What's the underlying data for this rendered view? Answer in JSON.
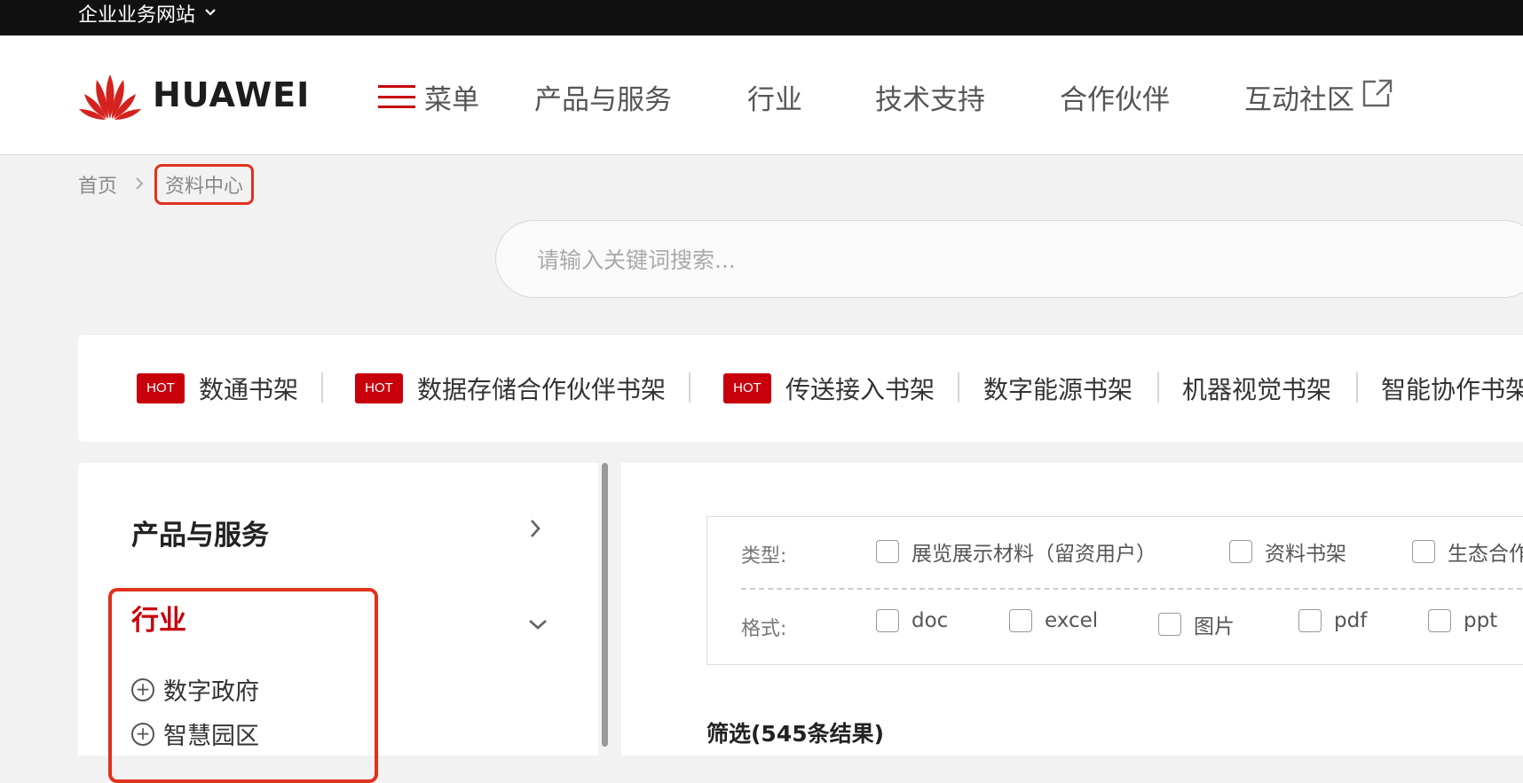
{
  "topbar": {
    "site_label": "企业业务网站",
    "chevron": "chevron-down-icon"
  },
  "header": {
    "logo_text": "HUAWEI",
    "brand_color": "#c7000b",
    "nav": [
      {
        "label": "菜单",
        "icon": "hamburger-icon"
      },
      {
        "label": "产品与服务"
      },
      {
        "label": "行业"
      },
      {
        "label": "技术支持"
      },
      {
        "label": "合作伙伴"
      },
      {
        "label": "互动社区",
        "icon": "external-link-icon"
      }
    ]
  },
  "breadcrumb": {
    "home": "首页",
    "current": "资料中心"
  },
  "search": {
    "placeholder": "请输入关键词搜索..."
  },
  "shelves": [
    {
      "label": "数通书架",
      "badge": "HOT"
    },
    {
      "label": "数据存储合作伙伴书架",
      "badge": "HOT"
    },
    {
      "label": "传送接入书架",
      "badge": "HOT"
    },
    {
      "label": "数字能源书架"
    },
    {
      "label": "机器视觉书架"
    },
    {
      "label": "智能协作书架"
    }
  ],
  "sidebar": {
    "sections": [
      {
        "title": "产品与服务",
        "state": "collapsed"
      },
      {
        "title": "行业",
        "state": "expanded",
        "active_color": "#c7000b"
      }
    ],
    "industry_items": [
      "数字政府",
      "智慧园区"
    ]
  },
  "filters": {
    "type_label": "类型:",
    "type_options": [
      "展览展示材料（留资用户）",
      "资料书架",
      "生态合作"
    ],
    "format_label": "格式:",
    "format_options": [
      "doc",
      "excel",
      "图片",
      "pdf",
      "ppt"
    ]
  },
  "results": {
    "label": "筛选(545条结果)"
  }
}
